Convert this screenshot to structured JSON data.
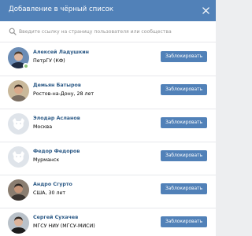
{
  "dialog": {
    "title": "Добавление в чёрный список",
    "close_icon": "close-icon"
  },
  "search": {
    "placeholder": "Введите ссылку на страницу пользователя или сообщества",
    "value": "",
    "icon": "search-icon"
  },
  "users": [
    {
      "name": "Алексей Ладушкин",
      "info": "ПетрГУ (КФ)",
      "online": true,
      "avatar": "photo"
    },
    {
      "name": "Демьян Батыров",
      "info": "Ростов-на-Дону, 28 лет",
      "online": false,
      "avatar": "photo"
    },
    {
      "name": "Элодар Асланов",
      "info": "Москва",
      "online": false,
      "avatar": "placeholder"
    },
    {
      "name": "Федор Федоров",
      "info": "Мурманск",
      "online": false,
      "avatar": "placeholder"
    },
    {
      "name": "Андро Сгурто",
      "info": "США, 30 лет",
      "online": false,
      "avatar": "photo"
    },
    {
      "name": "Сергей Сухачев",
      "info": "МГСУ НИУ (МГСУ-МИСИ)",
      "online": false,
      "avatar": "photo"
    }
  ],
  "block_button_label": "Заблокировать",
  "colors": {
    "header": "#5181b8",
    "button": "#5181b8",
    "name": "#2a5885",
    "online": "#8ac176",
    "placeholder_avatar": "#dfe4ea"
  }
}
